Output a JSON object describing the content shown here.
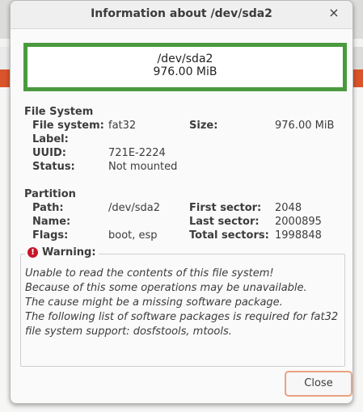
{
  "dialog": {
    "title": "Information about /dev/sda2",
    "close_glyph": "×"
  },
  "header": {
    "device": "/dev/sda2",
    "size": "976.00 MiB",
    "border_color": "#4a9a3e"
  },
  "filesystem": {
    "section_title": "File System",
    "fs_label": "File system:",
    "fs_value": "fat32",
    "label_label": "Label:",
    "label_value": "",
    "uuid_label": "UUID:",
    "uuid_value": "721E-2224",
    "status_label": "Status:",
    "status_value": "Not mounted",
    "size_label": "Size:",
    "size_value": "976.00 MiB"
  },
  "partition": {
    "section_title": "Partition",
    "path_label": "Path:",
    "path_value": "/dev/sda2",
    "name_label": "Name:",
    "name_value": "",
    "flags_label": "Flags:",
    "flags_value": "boot, esp",
    "first_sector_label": "First sector:",
    "first_sector_value": "2048",
    "last_sector_label": "Last sector:",
    "last_sector_value": "2000895",
    "total_sectors_label": "Total sectors:",
    "total_sectors_value": "1998848"
  },
  "warning": {
    "title": "Warning:",
    "icon": "error-icon",
    "lines": [
      "Unable to read the contents of this file system!",
      "Because of this some operations may be unavailable.",
      "The cause might be a missing software package.",
      "The following list of software packages is required for fat32",
      "file system support:  dosfstools, mtools."
    ]
  },
  "buttons": {
    "close_label": "Close"
  },
  "colors": {
    "accent_orange": "#d9532b",
    "focus_border": "#e9a281",
    "error_red": "#c7162b"
  }
}
